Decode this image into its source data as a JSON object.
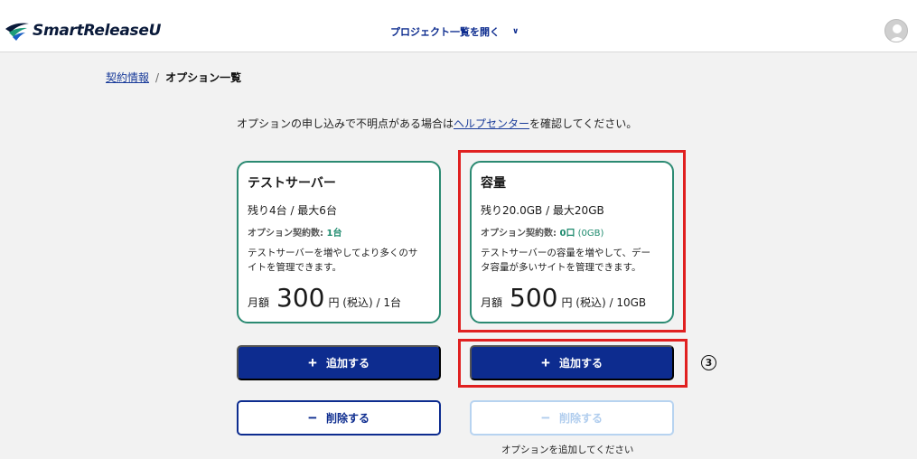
{
  "header": {
    "logo_text": "SmartRelease",
    "logo_u": "U",
    "project_menu_label": "プロジェクト一覧を開く"
  },
  "breadcrumb": {
    "parent": "契約情報",
    "separator": "/",
    "current": "オプション一覧"
  },
  "intro": {
    "before": "オプションの申し込みで不明点がある場合は",
    "link": "ヘルプセンター",
    "after": "を確認してください。"
  },
  "cards": [
    {
      "title": "テストサーバー",
      "remaining": "残り4台 / 最大6台",
      "contract_label": "オプション契約数: ",
      "contract_value": "1台",
      "contract_sub": "",
      "desc_line1": "テストサーバーを増やしてより多くのサ",
      "desc_line2": "イトを管理できます。",
      "price_prefix": "月額",
      "price_value": "300",
      "price_suffix": "円 (税込) / 1台",
      "add_label": "追加する",
      "delete_label": "削除する"
    },
    {
      "title": "容量",
      "remaining": "残り20.0GB / 最大20GB",
      "contract_label": "オプション契約数: ",
      "contract_value": "0口",
      "contract_sub": " (0GB)",
      "desc_line1": "テストサーバーの容量を増やして、デー",
      "desc_line2": "タ容量が多いサイトを管理できます。",
      "price_prefix": "月額",
      "price_value": "500",
      "price_suffix": "円 (税込) / 10GB",
      "add_label": "追加する",
      "delete_label": "削除する"
    }
  ],
  "symbols": {
    "plus": "+",
    "minus": "−",
    "chevron": "∨"
  },
  "step_mark": "3",
  "note": "オプションを追加してください",
  "colors": {
    "primary": "#0d2c8f",
    "card_border": "#2b8a72",
    "highlight": "#e02020",
    "disabled": "#b7d3f0"
  }
}
